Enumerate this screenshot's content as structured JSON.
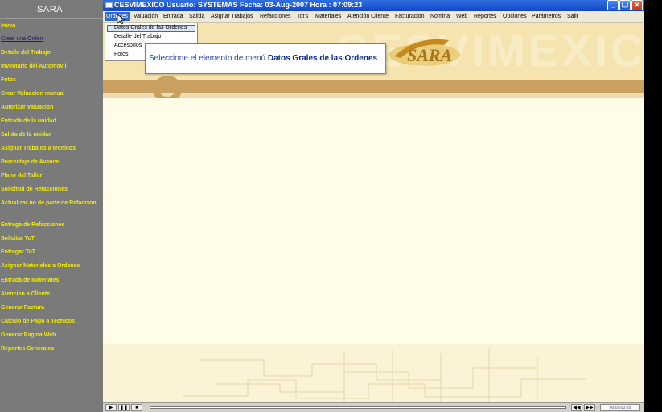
{
  "sidebar": {
    "title": "SARA",
    "items": [
      {
        "label": "Inicio",
        "link": false
      },
      {
        "label": "Crear una Orden",
        "link": true
      },
      {
        "label": "Detalle del Trabajo",
        "link": false
      },
      {
        "label": "Inventario del Automovil",
        "link": false
      },
      {
        "label": "Fotos",
        "link": false
      },
      {
        "label": "Crear Valuacion manual",
        "link": false
      },
      {
        "label": "Autorizar Valuacion",
        "link": false
      },
      {
        "label": "Entrada de la unidad",
        "link": false
      },
      {
        "label": "Salida de la unidad",
        "link": false
      },
      {
        "label": "Asignar Trabajos a tecnicos",
        "link": false
      },
      {
        "label": "Porcentaje de Avance",
        "link": false
      },
      {
        "label": "Plano del Taller",
        "link": false
      },
      {
        "label": "Solicitud de Refacciones",
        "link": false
      },
      {
        "label": "Actualizar no de parte de Refaccion",
        "link": false
      },
      {
        "label": "Entrega de Refacciones",
        "link": false
      },
      {
        "label": "Solicitar ToT",
        "link": false
      },
      {
        "label": "Entregar ToT",
        "link": false
      },
      {
        "label": "Asignar Materiales a Ordenes",
        "link": false
      },
      {
        "label": "Entrada de Materiales",
        "link": false
      },
      {
        "label": "Atencion a Cliente",
        "link": false
      },
      {
        "label": "Generar Factura",
        "link": false
      },
      {
        "label": "Calculo de Pago a Tecnicos",
        "link": false
      },
      {
        "label": "Generar Pagina Web",
        "link": false
      },
      {
        "label": "Reportes Generales",
        "link": false
      }
    ]
  },
  "window": {
    "title": "CESVIMEXICO   Usuario: SYSTEMAS      Fecha: 03-Aug-2007  Hora : 07:09:23",
    "controls": {
      "minimize": "_",
      "restore": "❐",
      "close": "✕"
    }
  },
  "menubar": {
    "items": [
      "Ordenes",
      "Valuación",
      "Entrada",
      "Salida",
      "Asignar Trabajos",
      "Refacciones",
      "Tot's",
      "Materiales",
      "Atención Cliente",
      "Facturacion",
      "Nomina",
      "Web",
      "Reportes",
      "Opciones",
      "Parámetros",
      "Salir"
    ],
    "active": "Ordenes"
  },
  "dropdown": {
    "items": [
      "Datos Grales de las Ordenes",
      "Detalle del Trabajo",
      "Accesorios",
      "Fotos"
    ],
    "highlighted": "Datos Grales de las Ordenes"
  },
  "tooltip": {
    "prefix": "Seleccione el elemento de menú",
    "target": "Datos Grales de las Ordenes"
  },
  "background": {
    "watermark": "CESVIMEXICO",
    "logo": "SARA"
  },
  "player": {
    "play": "▶",
    "pause": "❚❚",
    "stop": "■",
    "rewind": "◀◀",
    "forward": "▶▶",
    "time": "00:05/00:05"
  },
  "colors": {
    "sidebar_bg": "#7a7a7a",
    "sidebar_text": "#f2ea00",
    "titlebar": "#1246c8",
    "accent_brown": "#c9a060",
    "tooltip_text": "#2a4aa8"
  }
}
